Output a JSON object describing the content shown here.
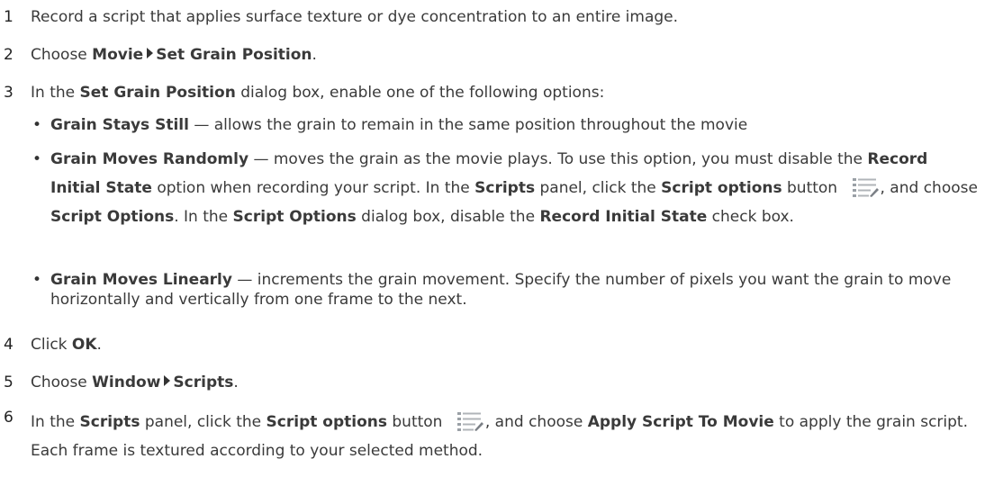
{
  "steps": [
    {
      "num": "1",
      "text": "Record a script that applies surface texture or dye concentration to an entire image."
    },
    {
      "num": "2",
      "pre": "Choose ",
      "menu1": "Movie",
      "menu2": "Set Grain Position",
      "post": "."
    },
    {
      "num": "3",
      "pre": "In the ",
      "bold": "Set Grain Position",
      "post": " dialog box, enable one of the following options:"
    },
    {
      "num": "4",
      "pre": "Click ",
      "bold": "OK",
      "post": "."
    },
    {
      "num": "5",
      "pre": "Choose ",
      "menu1": "Window",
      "menu2": "Scripts",
      "post": "."
    },
    {
      "num": "6",
      "t1": "In the ",
      "b1": "Scripts",
      "t2": " panel, click the ",
      "b2": "Script options",
      "t3": " button ",
      "t4": ", and choose ",
      "b3": "Apply Script To Movie",
      "t5": " to apply the grain script. Each frame is textured according to your selected method."
    }
  ],
  "options": [
    {
      "bold": "Grain Stays Still",
      "text": " — allows the grain to remain in the same position throughout the movie"
    },
    {
      "bold": "Grain Moves Randomly",
      "t1": " — moves the grain as the movie plays. To use this option, you must disable the ",
      "b1": "Record Initial State",
      "t2": " option when recording your script. In the ",
      "b2": "Scripts",
      "t3": " panel, click the ",
      "b3": "Script options",
      "t4": " button ",
      "t5": ", and choose ",
      "b4": "Script Options",
      "t6": ". In the ",
      "b5": "Script Options",
      "t7": " dialog box, disable the ",
      "b6": "Record Initial State",
      "t8": " check box."
    },
    {
      "bold": "Grain Moves Linearly",
      "text": " — increments the grain movement. Specify the number of pixels you want the grain to move horizontally and vertically from one frame to the next."
    }
  ],
  "bullet_char": "•",
  "icons": {
    "script_options": "script-options-icon"
  }
}
